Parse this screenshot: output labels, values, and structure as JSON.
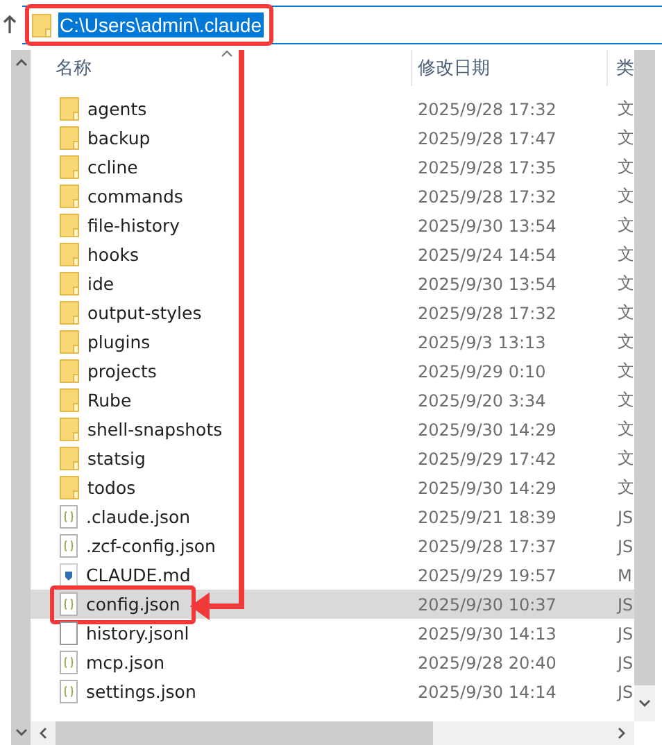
{
  "address_bar": {
    "path": "C:\\Users\\admin\\.claude",
    "text_selected": true,
    "annotated": true
  },
  "columns": [
    {
      "label": "名称",
      "sorted": true
    },
    {
      "label": "修改日期",
      "sorted": false
    },
    {
      "label": "类",
      "sorted": false
    }
  ],
  "files": [
    {
      "name": "agents",
      "modified": "2025/9/28 17:32",
      "type": "文",
      "kind": "folder",
      "selected": false,
      "annotated": false
    },
    {
      "name": "backup",
      "modified": "2025/9/28 17:47",
      "type": "文",
      "kind": "folder",
      "selected": false,
      "annotated": false
    },
    {
      "name": "ccline",
      "modified": "2025/9/28 17:35",
      "type": "文",
      "kind": "folder",
      "selected": false,
      "annotated": false
    },
    {
      "name": "commands",
      "modified": "2025/9/28 17:32",
      "type": "文",
      "kind": "folder",
      "selected": false,
      "annotated": false
    },
    {
      "name": "file-history",
      "modified": "2025/9/30 13:54",
      "type": "文",
      "kind": "folder",
      "selected": false,
      "annotated": false
    },
    {
      "name": "hooks",
      "modified": "2025/9/24 14:54",
      "type": "文",
      "kind": "folder",
      "selected": false,
      "annotated": false
    },
    {
      "name": "ide",
      "modified": "2025/9/30 13:54",
      "type": "文",
      "kind": "folder",
      "selected": false,
      "annotated": false
    },
    {
      "name": "output-styles",
      "modified": "2025/9/28 17:32",
      "type": "文",
      "kind": "folder",
      "selected": false,
      "annotated": false
    },
    {
      "name": "plugins",
      "modified": "2025/9/3 13:13",
      "type": "文",
      "kind": "folder",
      "selected": false,
      "annotated": false
    },
    {
      "name": "projects",
      "modified": "2025/9/29 0:10",
      "type": "文",
      "kind": "folder",
      "selected": false,
      "annotated": false
    },
    {
      "name": "Rube",
      "modified": "2025/9/20 3:34",
      "type": "文",
      "kind": "folder",
      "selected": false,
      "annotated": false
    },
    {
      "name": "shell-snapshots",
      "modified": "2025/9/30 14:29",
      "type": "文",
      "kind": "folder",
      "selected": false,
      "annotated": false
    },
    {
      "name": "statsig",
      "modified": "2025/9/29 17:42",
      "type": "文",
      "kind": "folder",
      "selected": false,
      "annotated": false
    },
    {
      "name": "todos",
      "modified": "2025/9/30 14:29",
      "type": "文",
      "kind": "folder",
      "selected": false,
      "annotated": false
    },
    {
      "name": ".claude.json",
      "modified": "2025/9/21 18:39",
      "type": "JS",
      "kind": "json",
      "selected": false,
      "annotated": false
    },
    {
      "name": ".zcf-config.json",
      "modified": "2025/9/28 17:37",
      "type": "JS",
      "kind": "json",
      "selected": false,
      "annotated": false
    },
    {
      "name": "CLAUDE.md",
      "modified": "2025/9/29 19:57",
      "type": "M",
      "kind": "markdown",
      "selected": false,
      "annotated": false
    },
    {
      "name": "config.json",
      "modified": "2025/9/30 10:37",
      "type": "JS",
      "kind": "json",
      "selected": true,
      "annotated": true
    },
    {
      "name": "history.jsonl",
      "modified": "2025/9/30 14:13",
      "type": "JS",
      "kind": "text",
      "selected": false,
      "annotated": false
    },
    {
      "name": "mcp.json",
      "modified": "2025/9/28 20:40",
      "type": "JS",
      "kind": "json",
      "selected": false,
      "annotated": false
    },
    {
      "name": "settings.json",
      "modified": "2025/9/30 14:14",
      "type": "JS",
      "kind": "json",
      "selected": false,
      "annotated": false
    }
  ],
  "arrow": {
    "shown": true
  }
}
